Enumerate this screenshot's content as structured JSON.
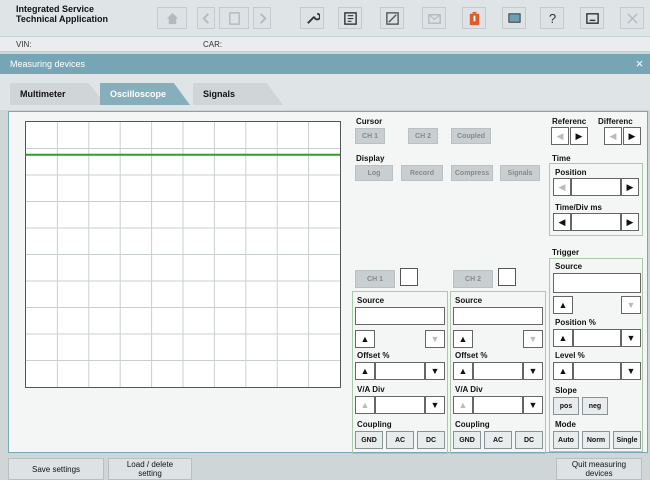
{
  "app": {
    "title": "Integrated Service\nTechnical Application"
  },
  "info": {
    "vin_label": "VIN:",
    "car_label": "CAR:"
  },
  "window": {
    "title": "Measuring devices"
  },
  "tabs": [
    {
      "label": "Multimeter"
    },
    {
      "label": "Oscilloscope"
    },
    {
      "label": "Signals"
    }
  ],
  "cursor": {
    "label": "Cursor",
    "ch1": "CH 1",
    "ch2": "CH 2",
    "coupled": "Coupled"
  },
  "display": {
    "label": "Display",
    "log": "Log",
    "record": "Record",
    "compress": "Compress",
    "signals": "Signals"
  },
  "reference": {
    "label": "Referenc",
    "difference_label": "Differenc"
  },
  "time": {
    "label": "Time",
    "position": "Position",
    "timediv": "Time/Div ms"
  },
  "trigger": {
    "label": "Trigger",
    "source": "Source",
    "position": "Position %",
    "level": "Level %",
    "slope": "Slope",
    "pos": "pos",
    "neg": "neg",
    "mode": "Mode",
    "auto": "Auto",
    "norm": "Norm",
    "single": "Single"
  },
  "ch1": {
    "label": "CH 1",
    "source": "Source",
    "offset": "Offset %",
    "vadiv": "V/A Div",
    "coupling": "Coupling",
    "gnd": "GND",
    "ac": "AC",
    "dc": "DC"
  },
  "ch2": {
    "label": "CH 2",
    "source": "Source",
    "offset": "Offset %",
    "vadiv": "V/A Div",
    "coupling": "Coupling",
    "gnd": "GND",
    "ac": "AC",
    "dc": "DC"
  },
  "bottom": {
    "save": "Save settings",
    "load": "Load / delete\nsetting",
    "quit": "Quit measuring\ndevices"
  },
  "colors": {
    "accent": "#76a6b6",
    "trace": "#2f9e2f",
    "warning": "#e05a2a"
  }
}
